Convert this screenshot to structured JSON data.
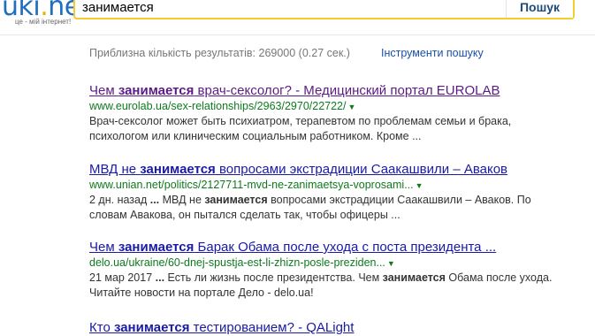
{
  "logo": {
    "main": "uki",
    "dot": ".",
    "suffix": "net",
    "tagline": "це - мій інтернет!"
  },
  "search": {
    "query": "занимается",
    "button_label": "Пошук"
  },
  "stats": {
    "text": "Приблизна кількість результатів: 269000 (0.27 сек.)",
    "tools_label": "Інструменти пошуку"
  },
  "results": [
    {
      "title_parts": [
        "Чем ",
        "занимается",
        " врач-сексолог? - Медицинский портал EUROLAB"
      ],
      "url": "www.eurolab.ua/sex-relationships/2963/2970/22722/",
      "snippet_line1": "Врач-сексолог может быть психиатром, терапевтом по проблемам семьи и брака,",
      "snippet_line2": "психологом или клиническим социальным работником. Кроме ..."
    },
    {
      "title_parts": [
        "МВД не ",
        "занимается",
        " вопросами экстрадиции Саакашвили – Аваков"
      ],
      "url": "www.unian.net/politics/2127711-mvd-ne-zanimaetsya-voprosami...",
      "snippet_parts": [
        "2 дн. назад ",
        "...",
        " МВД не ",
        "занимается",
        " вопросами экстрадиции Саакашвили – Аваков. По"
      ],
      "snippet_line2": "словам Авакова, он пытался сделать так, чтобы офицеры ..."
    },
    {
      "title_parts": [
        "Чем ",
        "занимается",
        " Барак Обама после ухода с поста президента ..."
      ],
      "url": "delo.ua/ukraine/60-dnej-spustja-est-li-zhizn-posle-preziden...",
      "snippet_parts": [
        "21 мар 2017 ",
        "...",
        " Есть ли жизнь после президентства. Чем ",
        "занимается",
        " Обама после ухода."
      ],
      "snippet_line2": "Читайте новости на портале Дело - delo.ua!"
    },
    {
      "title_parts": [
        "Кто ",
        "занимается",
        " тестированием? - QALight"
      ]
    }
  ],
  "colors": {
    "link": "#1a1aa6",
    "visited": "#5b1a86",
    "url": "#0e7a1e",
    "accent": "#f2cd2d"
  }
}
